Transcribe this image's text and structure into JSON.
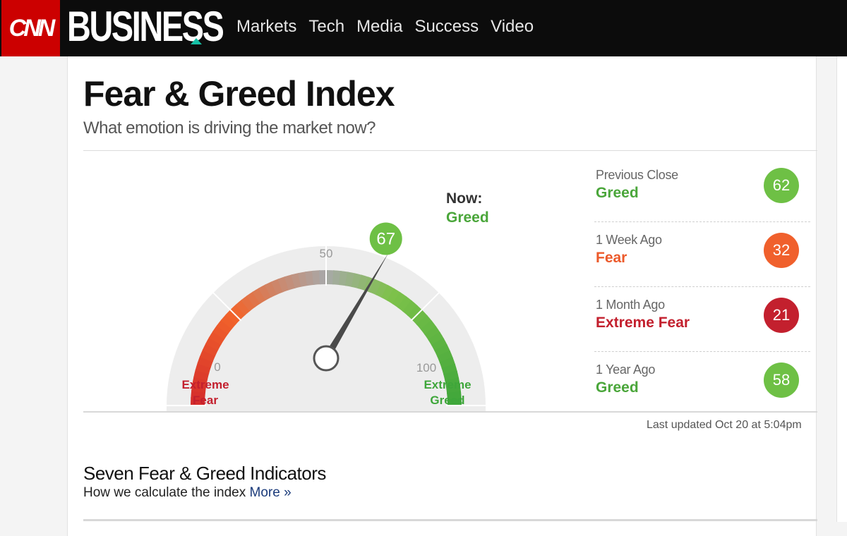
{
  "header": {
    "cnn_logo": "CNN",
    "section_logo": "BUSINESS",
    "nav": [
      "Markets",
      "Tech",
      "Media",
      "Success",
      "Video"
    ]
  },
  "page": {
    "title": "Fear & Greed Index",
    "subtitle": "What emotion is driving the market now?"
  },
  "gauge": {
    "value": 67,
    "scale": {
      "min": 0,
      "mid": 50,
      "max": 100
    },
    "label_min": "0",
    "label_mid": "50",
    "label_max": "100",
    "extreme_fear": [
      "Extreme",
      "Fear"
    ],
    "extreme_greed": [
      "Extreme",
      "Greed"
    ],
    "now_label": "Now:",
    "now_rating": "Greed",
    "value_text": "67",
    "colors": {
      "fear": "#d42b2b",
      "neutral": "#a0a0a0",
      "greed": "#3ea63a",
      "value_circle": "#6ec045"
    }
  },
  "history": [
    {
      "label": "Previous Close",
      "rating": "Greed",
      "value": "62",
      "rating_color": "#4aa63a",
      "circle_color": "#6ec045"
    },
    {
      "label": "1 Week Ago",
      "rating": "Fear",
      "value": "32",
      "rating_color": "#ec5a2b",
      "circle_color": "#f0602c"
    },
    {
      "label": "1 Month Ago",
      "rating": "Extreme Fear",
      "value": "21",
      "rating_color": "#c3202e",
      "circle_color": "#c3202e"
    },
    {
      "label": "1 Year Ago",
      "rating": "Greed",
      "value": "58",
      "rating_color": "#4aa63a",
      "circle_color": "#6ec045"
    }
  ],
  "last_updated": "Last updated Oct 20 at 5:04pm",
  "indicators": {
    "title": "Seven Fear & Greed Indicators",
    "subtitle": "How we calculate the index",
    "more_link": "More »"
  }
}
